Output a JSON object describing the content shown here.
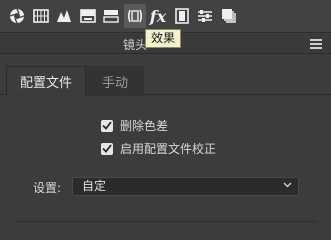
{
  "toolbar": {
    "icons": [
      "aperture-icon",
      "histogram-grid-icon",
      "triangle-tone-icon",
      "split-toning-icon",
      "hsl-bars-icon",
      "lens-correction-icon",
      "fx-icon",
      "filmstrip-icon",
      "sliders-icon",
      "snapshots-icon"
    ],
    "fx_label": "fx",
    "tooltip": "效果"
  },
  "panel": {
    "title": "镜头"
  },
  "tabs": [
    {
      "label": "配置文件",
      "active": true
    },
    {
      "label": "手动",
      "active": false
    }
  ],
  "options": {
    "remove_ca": {
      "label": "删除色差",
      "checked": true
    },
    "enable_profile": {
      "label": "启用配置文件校正",
      "checked": true
    }
  },
  "settings": {
    "label": "设置:",
    "value": "自定"
  }
}
